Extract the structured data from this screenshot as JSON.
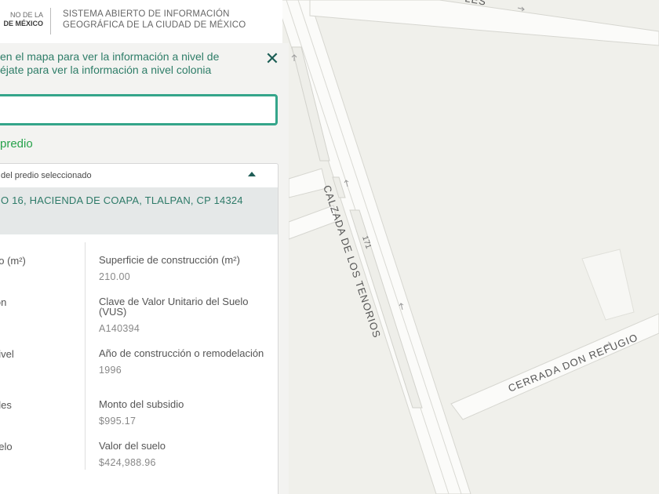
{
  "header": {
    "logo_line1": "NO DE LA",
    "logo_line2": "DE MÉXICO",
    "title_line1": "SISTEMA ABIERTO DE INFORMACIÓN",
    "title_line2": "GEOGRÁFICA DE LA CIUDAD DE MÉXICO"
  },
  "panel": {
    "instructions_line1": "en el mapa para ver la información a nivel de",
    "instructions_line2": "éjate para ver la información a nivel colonia",
    "close_symbol": "✕",
    "search_value": "",
    "section_title": "predio",
    "card": {
      "header_label": "del predio seleccionado",
      "address": "O 16, HACIENDA DE COAPA, TLALPAN, CP 14324",
      "left_labels": [
        "no (m²)",
        "ión",
        "nivel",
        "ales",
        "uelo"
      ],
      "fields": [
        {
          "label": "Superficie de construcción (m²)",
          "value": "210.00"
        },
        {
          "label": "Clave de Valor Unitario del Suelo (VUS)",
          "value": "A140394"
        },
        {
          "label": "Año de construcción o remodelación",
          "value": "1996"
        },
        {
          "label": "Monto del subsidio",
          "value": "$995.17"
        },
        {
          "label": "Valor del suelo",
          "value": "$424,988.96"
        }
      ]
    }
  },
  "map": {
    "street_main": "CALZADA DE LOS TENORIOS",
    "street_side": "CERRADA DON REFUGIO",
    "street_top": "LES",
    "road_number": "171",
    "pin_color": "#2f83c5"
  }
}
